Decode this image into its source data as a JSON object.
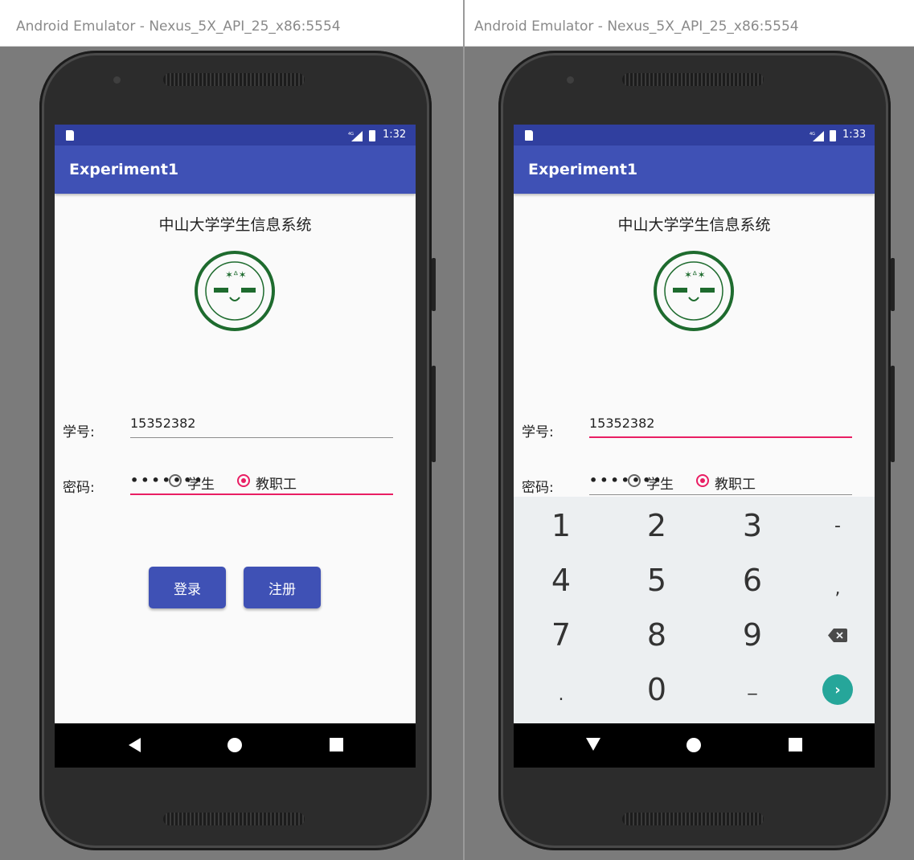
{
  "windows": [
    {
      "title": "Android Emulator - Nexus_5X_API_25_x86:5554",
      "status_time": "1:32",
      "app_title": "Experiment1",
      "heading": "中山大学学生信息系统",
      "logo_alt": "SUN YAT-SEN UNIVERSITY",
      "student_id_label": "学号:",
      "student_id_value": "15352382",
      "password_label": "密码:",
      "password_value": "•••••••",
      "radio_student": "学生",
      "radio_staff": "教职工",
      "login_button": "登录",
      "register_button": "注册"
    },
    {
      "title": "Android Emulator - Nexus_5X_API_25_x86:5554",
      "status_time": "1:33",
      "app_title": "Experiment1",
      "heading": "中山大学学生信息系统",
      "logo_alt": "SUN YAT-SEN UNIVERSITY",
      "student_id_label": "学号:",
      "student_id_value": "15352382",
      "password_label": "密码:",
      "password_value": "•••••••",
      "radio_student": "学生",
      "radio_staff": "教职工",
      "keypad": [
        "1",
        "2",
        "3",
        "-",
        "4",
        "5",
        "6",
        ",",
        "7",
        "8",
        "9",
        "backspace-icon",
        ".",
        "0",
        "_",
        "enter-icon"
      ]
    }
  ],
  "selected_radio": "教职工",
  "colors": {
    "primary": "#3f51b5",
    "primary_dark": "#303f9f",
    "accent": "#e91e63",
    "keypad_bg": "#eceff1",
    "enter_key": "#26a69a"
  }
}
